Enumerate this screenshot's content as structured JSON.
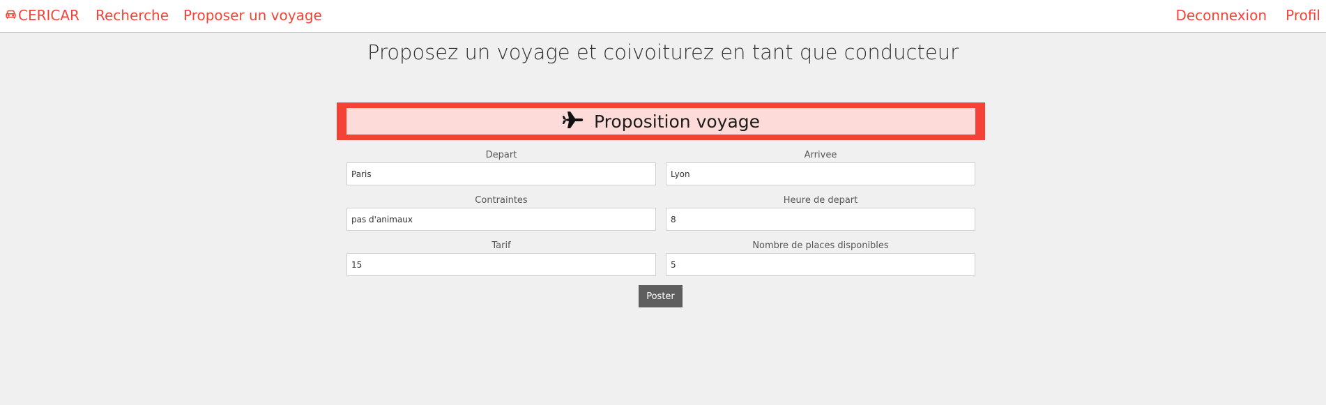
{
  "navbar": {
    "brand": "CERICAR",
    "brand_icon": "car-icon",
    "links": {
      "recherche": "Recherche",
      "proposer": "Proposer un voyage",
      "deconnexion": "Deconnexion",
      "profil": "Profil"
    }
  },
  "page": {
    "title": "Proposez un voyage et coivoiturez en tant que conducteur"
  },
  "form": {
    "header_icon": "plane-icon",
    "header_title": "Proposition voyage",
    "fields": {
      "depart": {
        "label": "Depart",
        "value": "Paris"
      },
      "arrivee": {
        "label": "Arrivee",
        "value": "Lyon"
      },
      "contraintes": {
        "label": "Contraintes",
        "value": "pas d'animaux"
      },
      "heure": {
        "label": "Heure de depart",
        "value": "8"
      },
      "tarif": {
        "label": "Tarif",
        "value": "15"
      },
      "places": {
        "label": "Nombre de places disponibles",
        "value": "5"
      }
    },
    "submit_label": "Poster"
  },
  "colors": {
    "accent": "#f44336",
    "header_bg": "#fddbd8",
    "button_bg": "#5e5e5e",
    "page_bg": "#f0f0f0"
  }
}
